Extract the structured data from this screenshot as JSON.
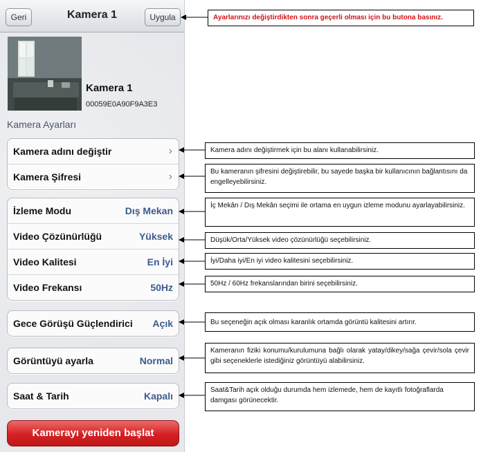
{
  "navbar": {
    "back_label": "Geri",
    "title": "Kamera 1",
    "apply_label": "Uygula"
  },
  "camera": {
    "name": "Kamera 1",
    "id": "00059E0A90F9A3E3"
  },
  "section_title": "Kamera Ayarları",
  "groups": {
    "name_pass": [
      {
        "label": "Kamera adını değiştir"
      },
      {
        "label": "Kamera Şifresi"
      }
    ],
    "video": [
      {
        "label": "İzleme Modu",
        "value": "Dış Mekan"
      },
      {
        "label": "Video Çözünürlüğü",
        "value": "Yüksek"
      },
      {
        "label": "Video Kalitesi",
        "value": "En İyi"
      },
      {
        "label": "Video Frekansı",
        "value": "50Hz"
      }
    ],
    "night": {
      "label": "Gece Görüşü Güçlendirici",
      "value": "Açık"
    },
    "image": {
      "label": "Görüntüyü ayarla",
      "value": "Normal"
    },
    "datetime": {
      "label": "Saat & Tarih",
      "value": "Kapalı"
    }
  },
  "restart_label": "Kamerayı yeniden başlat",
  "annotations": [
    "Ayarlarınızı değiştirdikten sonra geçerli olması için bu butona basınız.",
    "Kamera adını değiştirmek için bu alanı kullanabilirsiniz.",
    "Bu kameranın şifresini değiştirebilir, bu sayede başka bir kullanıcının bağlantısını da engelleyebilirsiniz.",
    "İç Mekân / Dış Mekân seçimi ile ortama en uygun izleme modunu ayarlayabilirsiniz.",
    "Düşük/Orta/Yüksek video çözünürlüğü seçebilirsiniz.",
    "İyi/Daha iyi/En iyi video kalitesini seçebilirsiniz.",
    "50Hz / 60Hz frekanslarından birini seçebilirsiniz.",
    "Bu seçeneğin açık olması karanlık ortamda görüntü kalitesini artırır.",
    "Kameranın fiziki konumu/kurulumuna bağlı olarak yatay/dikey/sağa çevir/sola çevir gibi seçeneklerle istediğiniz görüntüyü alabilirsiniz.",
    "Saat&Tarih açık olduğu durumda hem izlemede, hem de kayıtlı fotoğraflarda damgası görünecektir."
  ]
}
